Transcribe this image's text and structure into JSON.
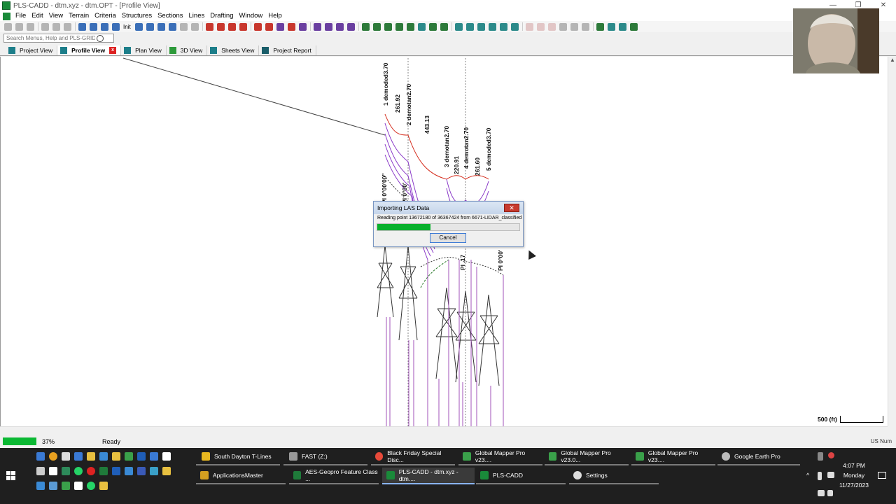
{
  "window": {
    "title": "PLS-CADD - dtm.xyz - dtm.OPT - [Profile View]",
    "controls": [
      "—",
      "❐",
      "✕"
    ]
  },
  "menu": [
    "File",
    "Edit",
    "View",
    "Terrain",
    "Criteria",
    "Structures",
    "Sections",
    "Lines",
    "Drafting",
    "Window",
    "Help"
  ],
  "toolbar": {
    "init_label": "Init"
  },
  "search": {
    "placeholder": "Search Menus, Help and PLS-GRID"
  },
  "tabs": [
    {
      "label": "Project View",
      "active": false
    },
    {
      "label": "Profile View",
      "active": true
    },
    {
      "label": "Plan View",
      "active": false
    },
    {
      "label": "3D View",
      "active": false
    },
    {
      "label": "Sheets View",
      "active": false
    },
    {
      "label": "Project Report",
      "active": false
    }
  ],
  "profile": {
    "labels": [
      "1 demoded3.70",
      "261.92",
      "2 demotan2.70",
      "443.13",
      "3 demotan2.70",
      "220.91",
      "4 demotan2.70",
      "261.60",
      "5 demoded3.70",
      "PI 0°00'00\"",
      "PI 0°00'",
      "PI .17",
      "PI 0°00'"
    ],
    "scale_label": "500 (ft)"
  },
  "dialog": {
    "title": "Importing LAS Data",
    "message": "Reading point 13672180 of 36367424 from 6671-LIDAR_classified",
    "progress": 0.376,
    "cancel": "Cancel",
    "close": "✕"
  },
  "status": {
    "percent": "37%",
    "percent_value": 0.37,
    "text": "Ready",
    "right": "US  Num"
  },
  "taskbar": {
    "row1": [
      {
        "label": "South Dayton T-Lines",
        "color": "#e8b820"
      },
      {
        "label": "FAST (Z:)",
        "color": "#9a9a9a"
      },
      {
        "label": "Black Friday Special Disc...",
        "color": "#e84a3a"
      },
      {
        "label": "Global Mapper Pro v23....",
        "color": "#3aa04a"
      },
      {
        "label": "Global Mapper Pro v23.0...",
        "color": "#3aa04a"
      },
      {
        "label": "Global Mapper Pro v23....",
        "color": "#3aa04a"
      },
      {
        "label": "Google Earth Pro",
        "color": "#bbbbbb"
      }
    ],
    "row2": [
      {
        "label": "ApplicationsMaster",
        "color": "#d4a020"
      },
      {
        "label": "AES-Geopro Feature Class ...",
        "color": "#1f7a3a"
      },
      {
        "label": "PLS-CADD - dtm.xyz - dtm....",
        "color": "#1a8a3a",
        "active": true
      },
      {
        "label": "PLS-CADD",
        "color": "#1a8a3a"
      },
      {
        "label": "Settings",
        "color": "#dddddd"
      }
    ],
    "clock": {
      "time": "4:07 PM",
      "day": "Monday",
      "date": "11/27/2023"
    }
  }
}
